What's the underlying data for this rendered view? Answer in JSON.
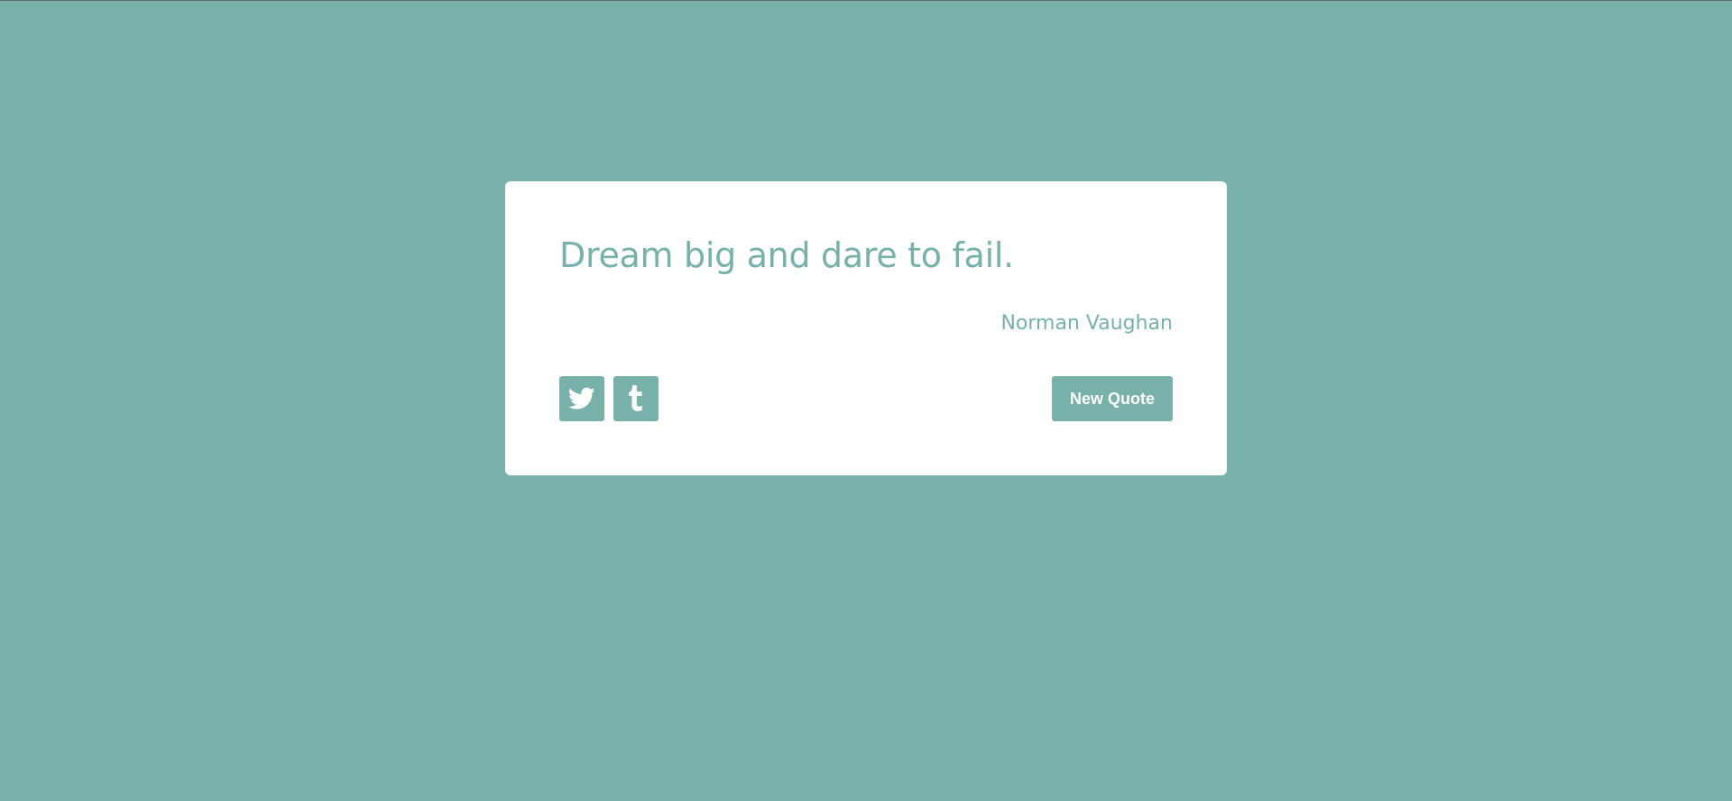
{
  "quote": {
    "text": "Dream big and dare to fail.",
    "author": "Norman Vaughan"
  },
  "actions": {
    "twitter_icon": "twitter-icon",
    "tumblr_icon": "tumblr-icon",
    "new_quote_label": "New Quote"
  },
  "colors": {
    "background": "#77b1a9",
    "card": "#ffffff",
    "accent": "#77b1a9"
  }
}
